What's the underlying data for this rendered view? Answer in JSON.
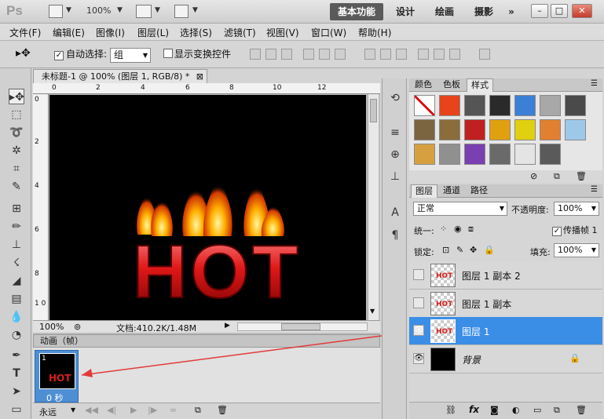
{
  "app": {
    "logo": "Ps",
    "zoom": "100%"
  },
  "workspaces": [
    "基本功能",
    "设计",
    "绘画",
    "摄影",
    "»"
  ],
  "menu": [
    "文件(F)",
    "编辑(E)",
    "图像(I)",
    "图层(L)",
    "选择(S)",
    "滤镜(T)",
    "视图(V)",
    "窗口(W)",
    "帮助(H)"
  ],
  "options": {
    "auto_select_label": "自动选择:",
    "auto_select_value": "组",
    "show_transform_label": "显示变换控件"
  },
  "document": {
    "tab_title": "未标题-1 @ 100% (图层 1, RGB/8) *",
    "ruler_top": [
      "0",
      "2",
      "4",
      "6",
      "8",
      "10",
      "12"
    ],
    "ruler_left": [
      "0",
      "2",
      "4",
      "6",
      "8",
      "1 0"
    ],
    "canvas_text": "HOT",
    "zoom": "100%",
    "doc_info": "文档:410.2K/1.48M"
  },
  "animation": {
    "title": "动画（帧）",
    "frame_number": "1",
    "frame_delay": "0 秒",
    "frame_thumb_text": "HOT",
    "loop": "永远"
  },
  "styles_panel": {
    "tabs": [
      "颜色",
      "色板",
      "样式"
    ],
    "swatches": [
      "#ffffff",
      "#e8431a",
      "#555555",
      "#2a2a2a",
      "#3b7fd6",
      "#a8a8a8",
      "#4a4a4a",
      "#7a6540",
      "#8a6d3a",
      "#c02020",
      "#e0a010",
      "#e0d010",
      "#e08030",
      "#9ec8e8",
      "#d6a040",
      "#909090",
      "#7a3fb0",
      "#6a6a6a",
      "#e4e4e4",
      "#5a5a5a"
    ]
  },
  "layers_panel": {
    "tabs": [
      "图层",
      "通道",
      "路径"
    ],
    "blend_mode": "正常",
    "opacity_label": "不透明度:",
    "opacity_value": "100%",
    "unify_label": "统一:",
    "propagate_label": "传播帧 1",
    "lock_label": "锁定:",
    "fill_label": "填充:",
    "fill_value": "100%",
    "layers": [
      {
        "name": "图层 1 副本 2",
        "visible": false,
        "selected": false
      },
      {
        "name": "图层 1 副本",
        "visible": false,
        "selected": false
      },
      {
        "name": "图层 1",
        "visible": true,
        "selected": true
      },
      {
        "name": "背景",
        "visible": true,
        "selected": false
      }
    ]
  },
  "colors": {
    "selection": "#3b8ee6",
    "arrow": "#e23a3a",
    "text_red": "#d81e1e"
  }
}
